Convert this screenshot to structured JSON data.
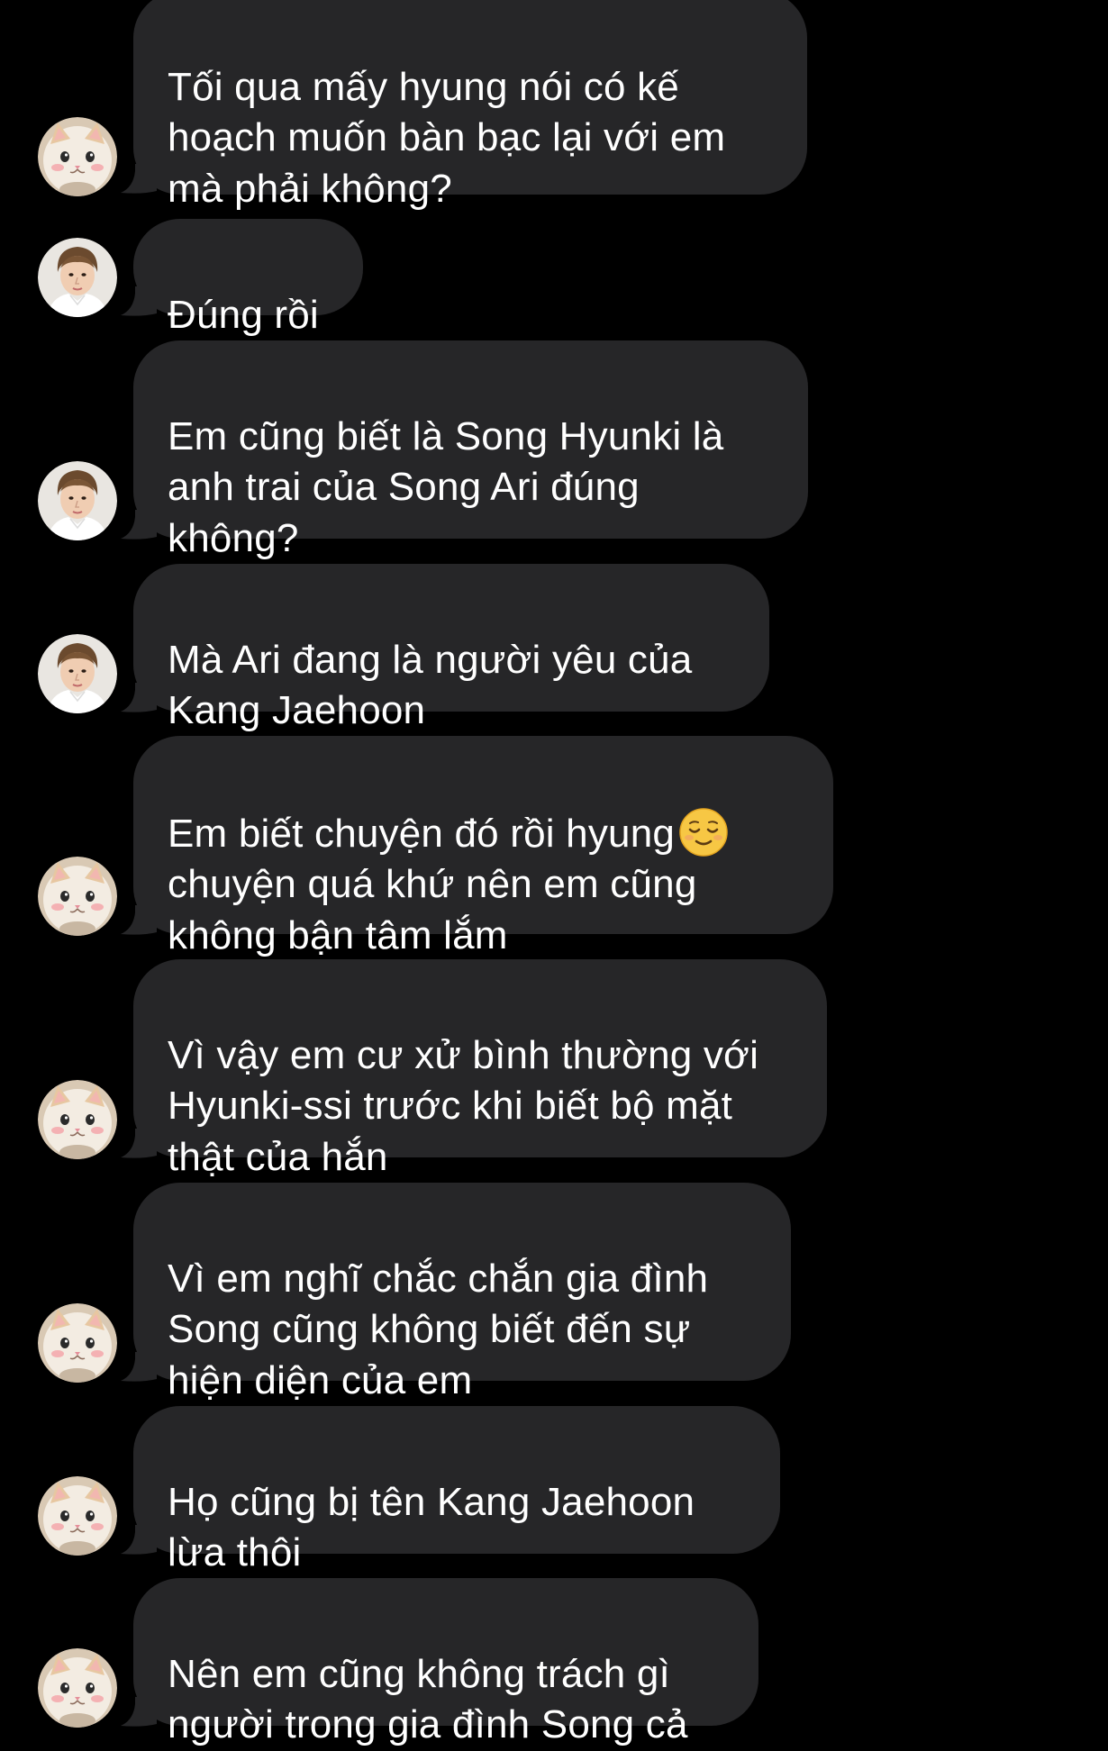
{
  "conversation": {
    "messages": [
      {
        "sender": "cat",
        "lines": "Tối qua mấy hyung nói có kế\nhoạch muốn bàn bạc lại với em\nmà phải không?"
      },
      {
        "sender": "jin",
        "lines": "Đúng rồi"
      },
      {
        "sender": "jin",
        "lines": "Em cũng biết là Song Hyunki là\nanh trai của Song Ari đúng\nkhông?"
      },
      {
        "sender": "jin",
        "lines": "Mà Ari đang là người yêu của\nKang Jaehoon"
      },
      {
        "sender": "cat",
        "lines": "Em biết chuyện đó rồi hyung",
        "lines_rest": "chuyện quá khứ nên em cũng\nkhông bận tâm lắm",
        "emoji": "relieved-face-emoji"
      },
      {
        "sender": "cat",
        "lines": "Vì vậy em cư xử bình thường với\nHyunki-ssi trước khi biết bộ mặt\nthật của hắn"
      },
      {
        "sender": "cat",
        "lines": "Vì em nghĩ chắc chắn gia đình\nSong cũng không biết đến sự\nhiện diện của em"
      },
      {
        "sender": "cat",
        "lines": "Họ cũng bị tên Kang Jaehoon\nlừa thôi"
      },
      {
        "sender": "cat",
        "lines": "Nên em cũng không trách gì\nngười trong gia đình Song cả"
      }
    ]
  },
  "colors": {
    "background": "#000000",
    "bubble": "#262628",
    "text": "#ffffff"
  },
  "icons": {
    "cat_avatar": "cat-avatar",
    "jin_avatar": "person-avatar",
    "emoji": "relieved-face-emoji"
  }
}
